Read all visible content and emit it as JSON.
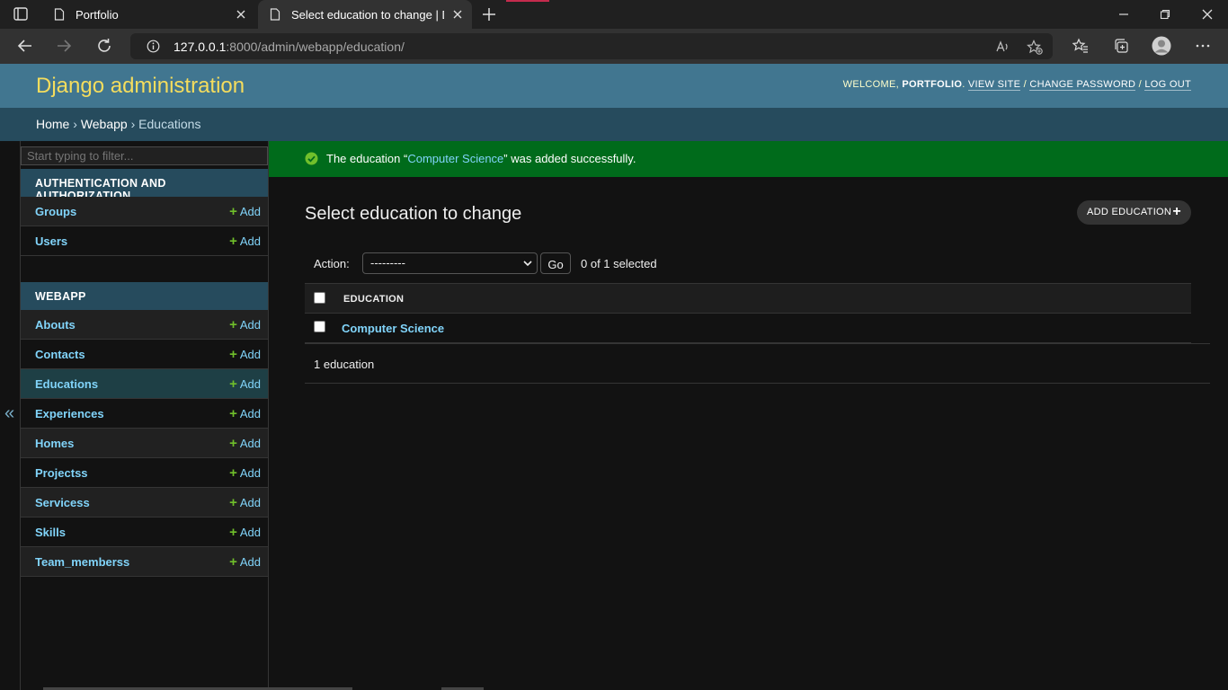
{
  "browser": {
    "tabs": [
      {
        "title": "Portfolio",
        "active": false
      },
      {
        "title": "Select education to change | Djan",
        "active": true
      }
    ],
    "url_host": "127.0.0.1",
    "url_rest": ":8000/admin/webapp/education/"
  },
  "header": {
    "brand": "Django administration",
    "welcome": "WELCOME,",
    "username": "PORTFOLIO",
    "view_site": "VIEW SITE",
    "change_password": "CHANGE PASSWORD",
    "log_out": "LOG OUT",
    "sep": "/"
  },
  "breadcrumbs": {
    "home": "Home",
    "app": "Webapp",
    "current": "Educations",
    "sep": "›"
  },
  "sidebar": {
    "toggle": "«",
    "filter_placeholder": "Start typing to filter...",
    "modules": [
      {
        "caption": "AUTHENTICATION AND AUTHORIZATION",
        "models": [
          {
            "name": "Groups",
            "add": "Add"
          },
          {
            "name": "Users",
            "add": "Add"
          }
        ]
      },
      {
        "caption": "WEBAPP",
        "models": [
          {
            "name": "Abouts",
            "add": "Add"
          },
          {
            "name": "Contacts",
            "add": "Add"
          },
          {
            "name": "Educations",
            "add": "Add",
            "current": true
          },
          {
            "name": "Experiences",
            "add": "Add"
          },
          {
            "name": "Homes",
            "add": "Add"
          },
          {
            "name": "Projectss",
            "add": "Add"
          },
          {
            "name": "Servicess",
            "add": "Add"
          },
          {
            "name": "Skills",
            "add": "Add"
          },
          {
            "name": "Team_memberss",
            "add": "Add"
          }
        ]
      }
    ]
  },
  "message": {
    "prefix": "The education “",
    "link": "Computer Science",
    "suffix": "” was added successfully."
  },
  "main": {
    "title": "Select education to change",
    "add_button": "ADD EDUCATION",
    "action_label": "Action:",
    "action_value": "---------",
    "go": "Go",
    "counter": "0 of 1 selected",
    "column_header": "EDUCATION",
    "rows": [
      "Computer Science"
    ],
    "paginator": "1 education"
  },
  "colors": {
    "header_bg": "#417690",
    "brand": "#f5dd5d",
    "breadcrumb_bg": "#264b5d",
    "link": "#81d4fa",
    "success_bg": "#006b1b",
    "add_green": "#70bf2b"
  }
}
